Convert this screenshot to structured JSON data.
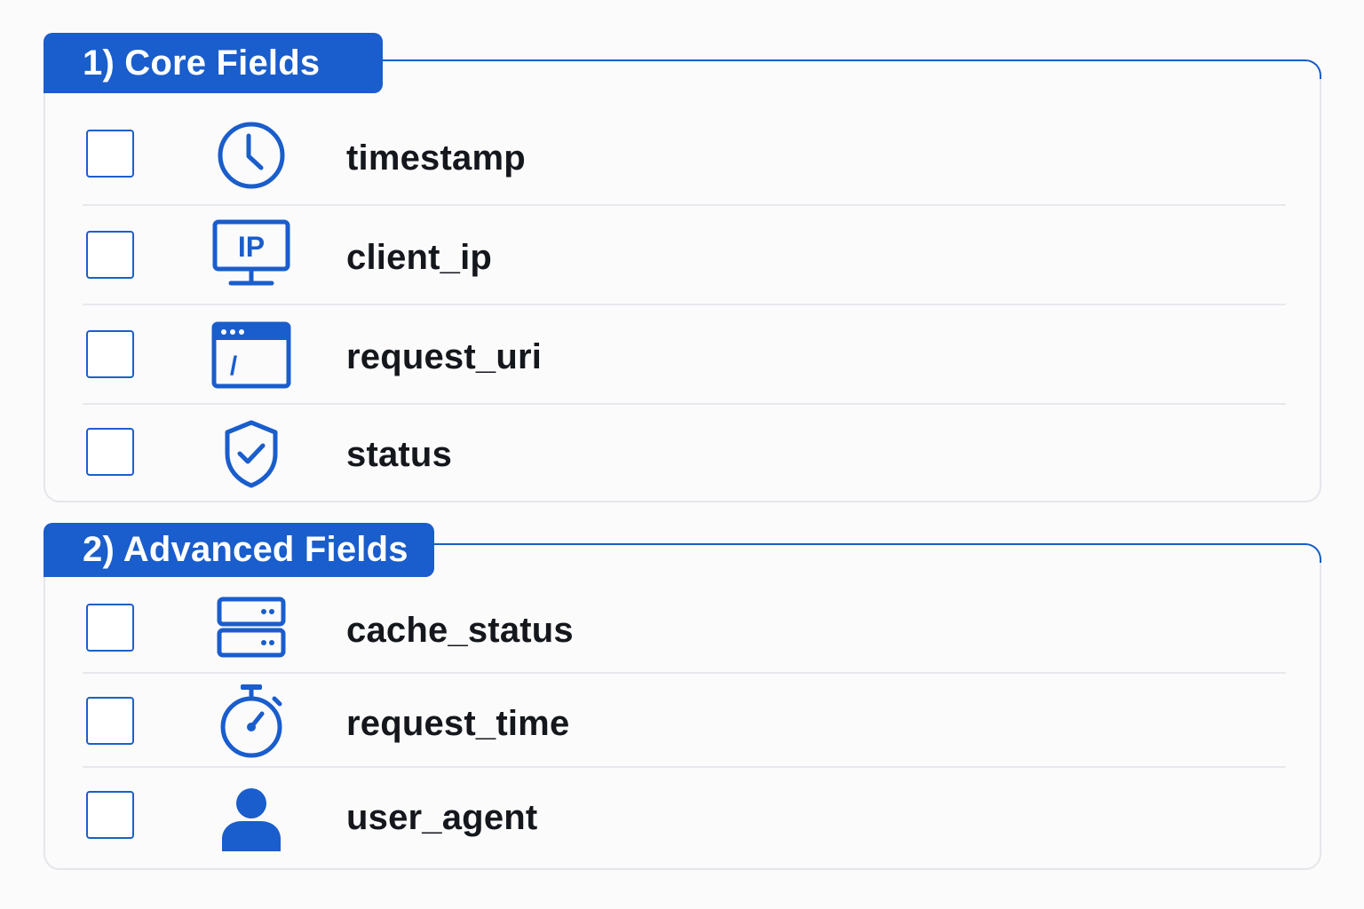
{
  "sections": [
    {
      "title": "1) Core Fields",
      "fields": [
        {
          "label": "timestamp",
          "icon": "clock-icon",
          "checked": false
        },
        {
          "label": "client_ip",
          "icon": "ip-monitor-icon",
          "checked": false
        },
        {
          "label": "request_uri",
          "icon": "browser-window-icon",
          "checked": false
        },
        {
          "label": "status",
          "icon": "shield-check-icon",
          "checked": false
        }
      ]
    },
    {
      "title": "2) Advanced Fields",
      "fields": [
        {
          "label": "cache_status",
          "icon": "server-icon",
          "checked": false
        },
        {
          "label": "request_time",
          "icon": "stopwatch-icon",
          "checked": false
        },
        {
          "label": "user_agent",
          "icon": "user-icon",
          "checked": false
        }
      ]
    }
  ],
  "icon_texts": {
    "ip": "IP",
    "slash": "/"
  },
  "colors": {
    "accent": "#1a5dcc",
    "text": "#14171c",
    "border": "#e4e6ea",
    "background": "#fbfbfc"
  }
}
